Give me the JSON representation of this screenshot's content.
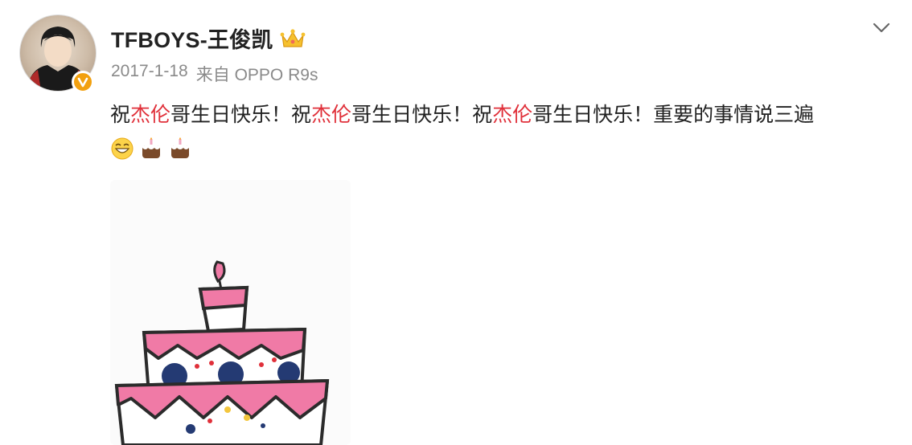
{
  "post": {
    "author": "TFBOYS-王俊凯",
    "date": "2017-1-18",
    "source": "来自 OPPO R9s",
    "text": {
      "p1": "祝",
      "h1": "杰伦",
      "p2": "哥生日快乐！祝",
      "h2": "杰伦",
      "p3": "哥生日快乐！祝",
      "h3": "杰伦",
      "p4": "哥生日快乐！重要的事情说三遍"
    },
    "emojis": [
      "grin-emoji-icon",
      "cake-icon",
      "cake-icon"
    ],
    "image": "birthday-cake-drawing"
  },
  "colors": {
    "highlight": "#e0303a",
    "verified": "#f2a00f",
    "cake_pink": "#f06a9a",
    "cake_navy": "#243a73"
  }
}
